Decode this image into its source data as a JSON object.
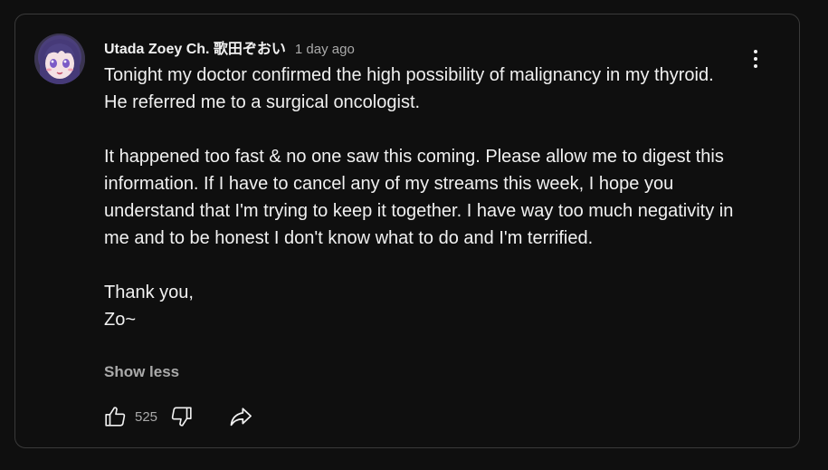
{
  "comment": {
    "author": "Utada Zoey Ch. 歌田ぞおい",
    "timestamp": "1 day ago",
    "paragraphs": [
      "Tonight my doctor confirmed the high possibility of malignancy in my thyroid. He referred me to a surgical oncologist.",
      "It happened too fast & no one saw this coming. Please allow me to digest this information. If I have to cancel any of my streams this week, I hope you understand that I'm trying to keep it together. I have way too much negativity in me and to be honest I don't know what to do and I'm terrified."
    ],
    "signoff_line1": "Thank you,",
    "signoff_line2": "Zo~",
    "show_less_label": "Show less"
  },
  "actions": {
    "like_count": "525"
  },
  "icons": {
    "like": "thumbs-up-icon",
    "dislike": "thumbs-down-icon",
    "share": "share-arrow-icon",
    "menu": "more-vertical-icon"
  },
  "colors": {
    "background": "#0f0f0f",
    "card_border": "#3a3a3a",
    "text_primary": "#f1f1f1",
    "text_secondary": "#aaaaaa"
  }
}
